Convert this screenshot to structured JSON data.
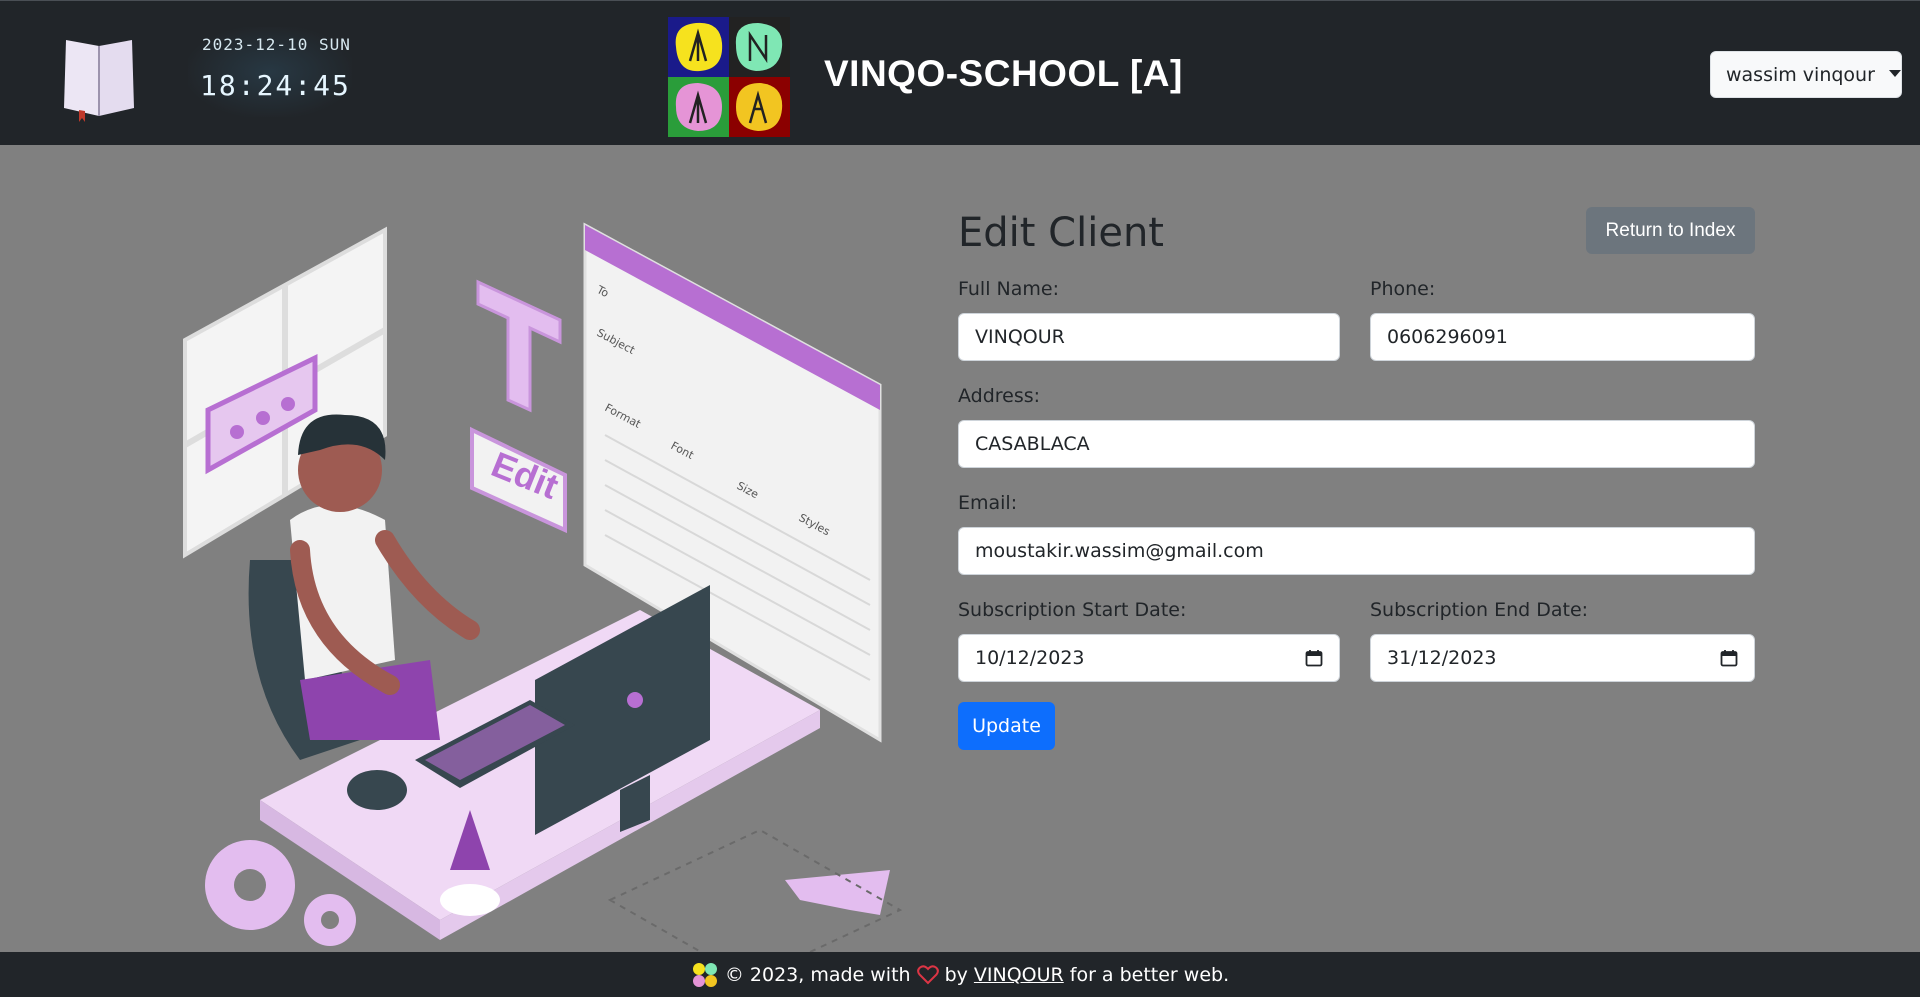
{
  "header": {
    "clock_date": "2023-12-10 SUN",
    "clock_time": "18:24:45",
    "brand": "VINQO-SCHOOL [A]",
    "user_menu_label": "wassim vinqour"
  },
  "form": {
    "title": "Edit Client",
    "return_label": "Return to Index",
    "full_name_label": "Full Name:",
    "full_name_value": "VINQOUR",
    "phone_label": "Phone:",
    "phone_value": "0606296091",
    "address_label": "Address:",
    "address_value": "CASABLACA",
    "email_label": "Email:",
    "email_value": "moustakir.wassim@gmail.com",
    "start_label": "Subscription Start Date:",
    "start_value": "10/12/2023",
    "end_label": "Subscription End Date:",
    "end_value": "31/12/2023",
    "update_label": "Update"
  },
  "illustration": {
    "edit_tag": "Edit",
    "to_label": "To",
    "subject_label": "Subject",
    "format_label": "Format",
    "font_label": "Font",
    "size_label": "Size",
    "styles_label": "Styles"
  },
  "footer": {
    "pre": "© 2023, made with",
    "by": "by",
    "author": "VINQOUR",
    "post": "for a better web."
  },
  "colors": {
    "navbar": "#212529",
    "page_bg": "#808080",
    "primary": "#0d6efd",
    "secondary": "#6c757d",
    "accent_purple": "#b76fd2",
    "heart": "#dc3545"
  }
}
